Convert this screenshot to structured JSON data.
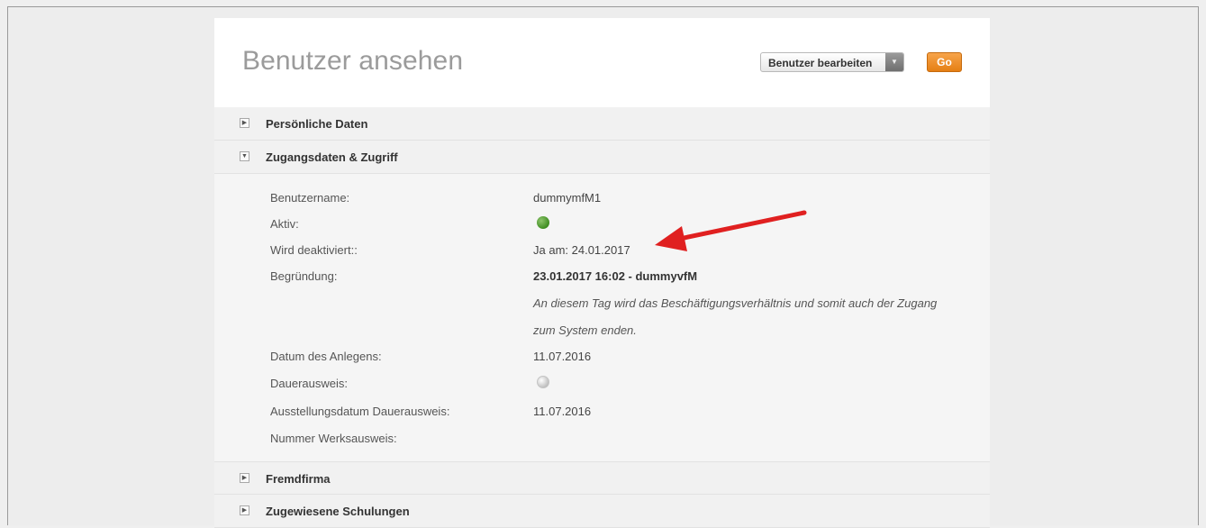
{
  "page": {
    "title": "Benutzer ansehen"
  },
  "actions": {
    "select_value": "Benutzer bearbeiten",
    "go_label": "Go"
  },
  "sections": {
    "personal": {
      "title": "Persönliche Daten",
      "expanded": false
    },
    "access": {
      "title": "Zugangsdaten & Zugriff",
      "expanded": true
    },
    "company": {
      "title": "Fremdfirma",
      "expanded": false
    },
    "trainings": {
      "title": "Zugewiesene Schulungen",
      "expanded": false
    }
  },
  "access_details": {
    "username_label": "Benutzername:",
    "username_value": "dummymfM1",
    "active_label": "Aktiv:",
    "active_value": "green",
    "deactivate_label": "Wird deaktiviert::",
    "deactivate_value": "Ja am: 24.01.2017",
    "reason_label": "Begründung:",
    "reason_header": "23.01.2017 16:02 - dummyvfM",
    "reason_line1": "An diesem Tag wird das Beschäftigungsverhältnis und somit auch der Zugang",
    "reason_line2": "zum System enden.",
    "created_label": "Datum des Anlegens:",
    "created_value": "11.07.2016",
    "permanent_pass_label": "Dauerausweis:",
    "permanent_pass_value": "grey",
    "issue_date_label": "Ausstellungsdatum Dauerausweis:",
    "issue_date_value": "11.07.2016",
    "works_id_label": "Nummer Werksausweis:",
    "works_id_value": ""
  },
  "colors": {
    "accent_orange": "#e8841a",
    "status_active": "#4a9a2a",
    "status_inactive": "#c8c8c8",
    "annotation_arrow": "#e02020"
  },
  "icons": {
    "collapsed": "triangle-right-icon",
    "expanded": "triangle-down-icon",
    "dropdown": "chevron-down-icon"
  }
}
